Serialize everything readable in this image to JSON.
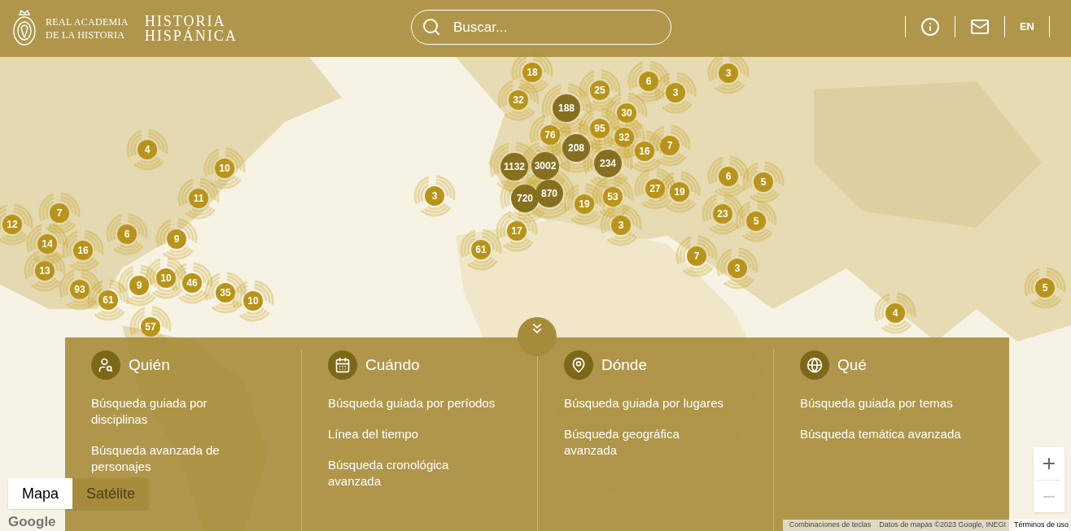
{
  "header": {
    "academy_lines": [
      "REAL ACADEMIA",
      "DE LA HISTORIA"
    ],
    "site_lines": [
      "HISTORIA",
      "HISPÁNICA"
    ],
    "search": {
      "placeholder": "Buscar..."
    },
    "language": "EN"
  },
  "markers": [
    {
      "count": "18",
      "kind": "small"
    },
    {
      "count": "32",
      "kind": "small"
    },
    {
      "count": "188",
      "kind": "large"
    },
    {
      "count": "25",
      "kind": "small"
    },
    {
      "count": "6",
      "kind": "small"
    },
    {
      "count": "3",
      "kind": "small"
    },
    {
      "count": "3",
      "kind": "small"
    },
    {
      "count": "30",
      "kind": "small"
    },
    {
      "count": "95",
      "kind": "small"
    },
    {
      "count": "76",
      "kind": "small"
    },
    {
      "count": "32",
      "kind": "small"
    },
    {
      "count": "208",
      "kind": "large"
    },
    {
      "count": "16",
      "kind": "small"
    },
    {
      "count": "7",
      "kind": "small"
    },
    {
      "count": "1132",
      "kind": "large"
    },
    {
      "count": "3002",
      "kind": "large"
    },
    {
      "count": "234",
      "kind": "large"
    },
    {
      "count": "720",
      "kind": "large"
    },
    {
      "count": "870",
      "kind": "large"
    },
    {
      "count": "19",
      "kind": "small"
    },
    {
      "count": "53",
      "kind": "small"
    },
    {
      "count": "27",
      "kind": "small"
    },
    {
      "count": "19",
      "kind": "small"
    },
    {
      "count": "3",
      "kind": "small"
    },
    {
      "count": "6",
      "kind": "small"
    },
    {
      "count": "5",
      "kind": "small"
    },
    {
      "count": "23",
      "kind": "small"
    },
    {
      "count": "5",
      "kind": "small"
    },
    {
      "count": "17",
      "kind": "small"
    },
    {
      "count": "61",
      "kind": "small"
    },
    {
      "count": "7",
      "kind": "small"
    },
    {
      "count": "3",
      "kind": "small"
    },
    {
      "count": "3",
      "kind": "small"
    },
    {
      "count": "4",
      "kind": "small"
    },
    {
      "count": "10",
      "kind": "small"
    },
    {
      "count": "11",
      "kind": "small"
    },
    {
      "count": "7",
      "kind": "small"
    },
    {
      "count": "12",
      "kind": "small"
    },
    {
      "count": "14",
      "kind": "small"
    },
    {
      "count": "16",
      "kind": "small"
    },
    {
      "count": "6",
      "kind": "small"
    },
    {
      "count": "9",
      "kind": "small"
    },
    {
      "count": "13",
      "kind": "small"
    },
    {
      "count": "93",
      "kind": "small"
    },
    {
      "count": "61",
      "kind": "small"
    },
    {
      "count": "9",
      "kind": "small"
    },
    {
      "count": "10",
      "kind": "small"
    },
    {
      "count": "46",
      "kind": "small"
    },
    {
      "count": "35",
      "kind": "small"
    },
    {
      "count": "10",
      "kind": "small"
    },
    {
      "count": "57",
      "kind": "small"
    },
    {
      "count": "5",
      "kind": "small"
    },
    {
      "count": "4",
      "kind": "small"
    }
  ],
  "map_type": [
    {
      "label": "Mapa",
      "selected": true
    },
    {
      "label": "Satélite",
      "selected": false
    }
  ],
  "google_logo": "Google",
  "zoom": {
    "in": "+",
    "out": "−"
  },
  "attribution": [
    "Combinaciones de teclas",
    "Datos de mapas ©2023 Google, INEGI",
    "Términos de uso"
  ],
  "search_panel": {
    "sections": [
      {
        "title": "Quién",
        "links": [
          "Búsqueda guiada por disciplinas",
          "Búsqueda avanzada de personajes"
        ]
      },
      {
        "title": "Cuándo",
        "links": [
          "Búsqueda guiada por períodos",
          "Línea del tiempo",
          "Búsqueda cronológica avanzada"
        ]
      },
      {
        "title": "Dónde",
        "links": [
          "Búsqueda guiada por lugares",
          "Búsqueda geográfica avanzada"
        ]
      },
      {
        "title": "Qué",
        "links": [
          "Búsqueda guiada por temas",
          "Búsqueda temática avanzada"
        ]
      }
    ]
  }
}
